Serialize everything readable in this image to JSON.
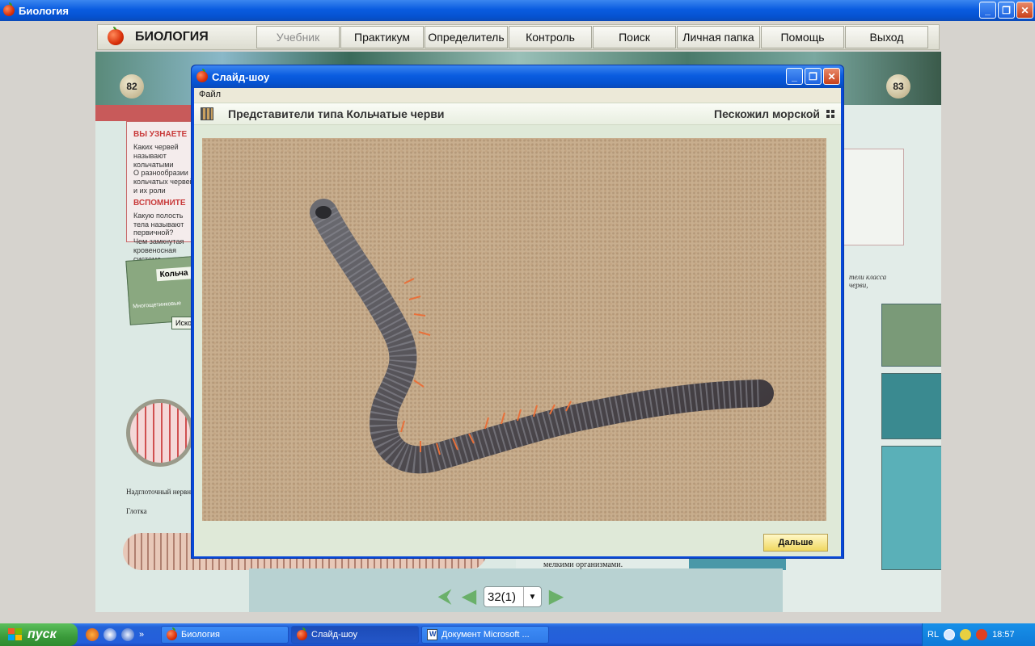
{
  "os_window": {
    "title": "Биология",
    "minimize": "_",
    "restore": "❐",
    "close": "✕"
  },
  "app_menu": {
    "logo": "БИОЛОГИЯ",
    "items": [
      "Учебник",
      "Практикум",
      "Определитель",
      "Контроль",
      "Поиск",
      "Личная папка",
      "Помощь",
      "Выход"
    ]
  },
  "book": {
    "page_left": "82",
    "page_right": "83",
    "left_box": {
      "heading1": "ВЫ УЗНАЕТЕ",
      "item1": "Каких червей называют кольчатыми",
      "item2": "О разнообразии кольчатых червей и их роли",
      "heading2": "ВСПОМНИТЕ",
      "item3": "Какую полость тела называют первичной?",
      "item4": "Чем замкнутая кровеносная система отличается"
    },
    "card_label": "Кольча",
    "card_text": "Многощетинковые",
    "card_text2": "Иско",
    "diagram_label1": "Надглоточный нервный узел",
    "diagram_label2": "Глотка",
    "right_text1": "тели класса",
    "right_text2": "черви,",
    "bottom_text": "мелкими организмами."
  },
  "page_nav": {
    "value": "32(1)",
    "dropdown_icon": "▼",
    "first_icon": "⮜",
    "prev_icon": "◀",
    "next_icon": "▶"
  },
  "dialog": {
    "title": "Слайд-шоу",
    "menu_file": "Файл",
    "header_title": "Представители типа Кольчатые черви",
    "specimen_name": "Пескожил морской",
    "next_button": "Дальше",
    "image_subject": "sea lugworm on sand"
  },
  "taskbar": {
    "start": "пуск",
    "quicklaunch_more": "»",
    "tasks": [
      "Биология",
      "Слайд-шоу",
      "Документ Microsoft ..."
    ],
    "lang": "RL",
    "clock": "18:57"
  },
  "colors": {
    "xp_blue": "#0a5ce0",
    "menu_bg": "#ece9d8",
    "next_button": "#f0d860"
  }
}
